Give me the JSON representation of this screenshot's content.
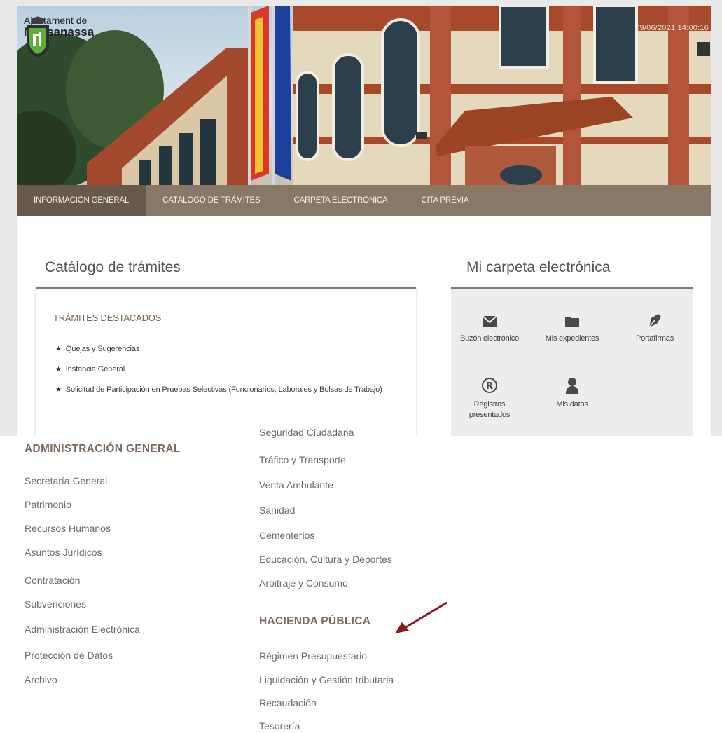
{
  "header": {
    "logo_line1": "Ajuntament de",
    "logo_line2": "Massanassa",
    "datetime": "09/06/2021 14:00:16"
  },
  "nav": {
    "items": [
      {
        "label": "INFORMACIÓN GENERAL",
        "active": true
      },
      {
        "label": "CATÁLOGO DE TRÁMITES",
        "active": false
      },
      {
        "label": "CARPETA ELECTRÓNICA",
        "active": false
      },
      {
        "label": "CITA PREVIA",
        "active": false
      }
    ]
  },
  "catalog": {
    "title": "Catálogo de trámites",
    "heading": "TRÁMITES DESTACADOS",
    "items": [
      "Quejas y Sugerencias",
      "Instancia General",
      "Solicitud de Participación en Pruebas Selectivas (Funcionarios, Laborales y Bolsas de Trabajo)"
    ]
  },
  "carpeta": {
    "title": "Mi carpeta electrónica",
    "tiles": [
      {
        "label": "Buzón electrónico",
        "icon": "envelope-icon"
      },
      {
        "label": "Mis expedientes",
        "icon": "folder-icon"
      },
      {
        "label": "Portafirmas",
        "icon": "pen-nib-icon"
      },
      {
        "label": "Registros presentados",
        "icon": "registered-icon"
      },
      {
        "label": "Mis datos",
        "icon": "user-icon"
      }
    ]
  },
  "listing": {
    "cut_item": "Seguridad Ciudadana",
    "admin_heading": "ADMINISTRACIÓN GENERAL",
    "admin_items": [
      "Secretaría General",
      "Patrimonio",
      "Recursos Humanos",
      "Asuntos Jurídicos",
      "Contratación",
      "Subvenciones",
      "Administración Electrónica",
      "Protección de Datos",
      "Archivo"
    ],
    "right_items": [
      "Tráfico y Transporte",
      "Venta Ambulante",
      "Sanidad",
      "Cementerios",
      "Educación, Cultura y Deportes",
      "Arbitraje y Consumo"
    ],
    "hacienda_heading": "HACIENDA PÚBLICA",
    "hacienda_items": [
      "Régimen Presupuestario",
      "Liquidación y Gestión tributaria",
      "Recaudación",
      "Tesorería"
    ]
  },
  "colors": {
    "nav_bg": "#8a7866",
    "nav_active": "#68594c",
    "accent": "#8a7866",
    "arrow": "#8b1a1a"
  }
}
